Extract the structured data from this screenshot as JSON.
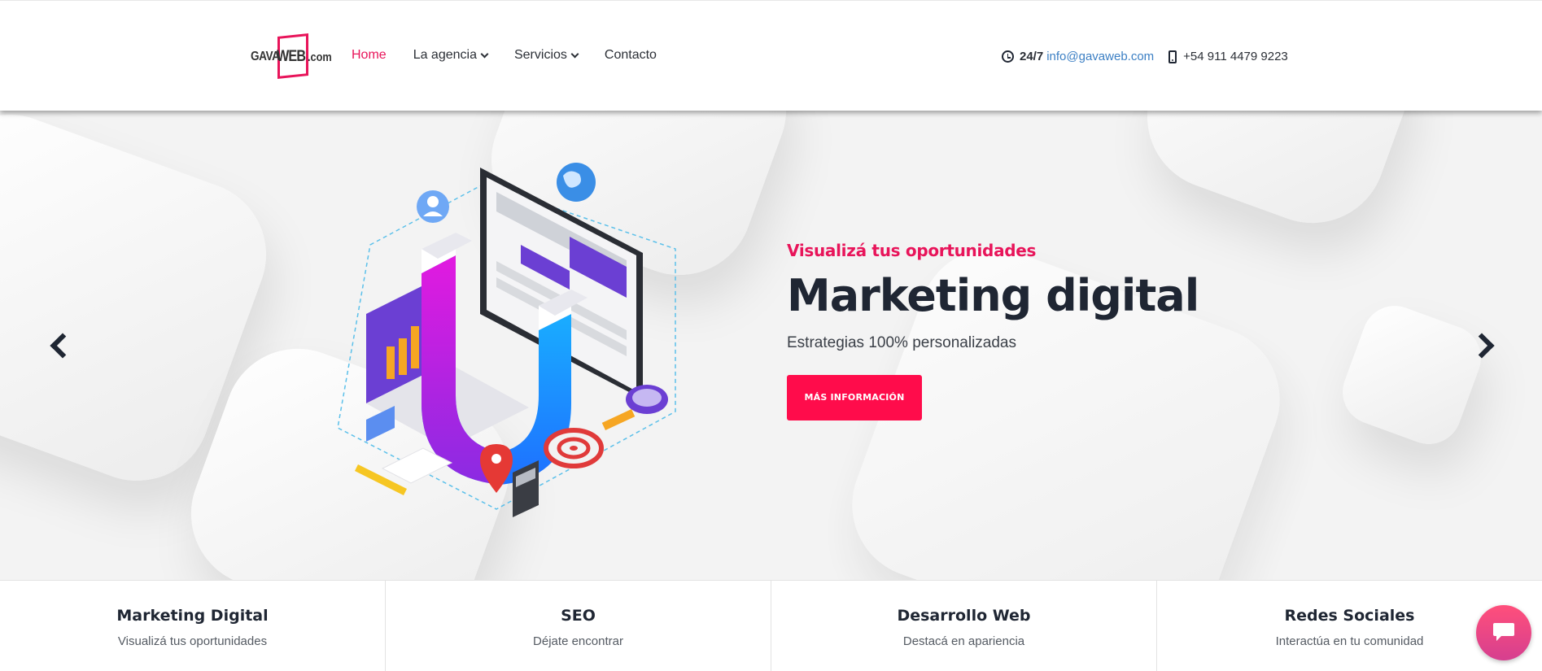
{
  "header": {
    "logo": {
      "part1": "GAVA",
      "part2": "WEB",
      "part3": ".com"
    },
    "nav": [
      {
        "label": "Home",
        "active": true,
        "has_dropdown": false
      },
      {
        "label": "La agencia",
        "active": false,
        "has_dropdown": true
      },
      {
        "label": "Servicios",
        "active": false,
        "has_dropdown": true
      },
      {
        "label": "Contacto",
        "active": false,
        "has_dropdown": false
      }
    ],
    "contact": {
      "hours": "24/7",
      "email": "info@gavaweb.com",
      "phone": "+54 911 4479 9223"
    }
  },
  "hero": {
    "kicker": "Visualizá tus oportunidades",
    "headline": "Marketing digital",
    "subline": "Estrategias 100% personalizadas",
    "cta_label": "MÁS INFORMACIÓN"
  },
  "services": [
    {
      "title": "Marketing Digital",
      "subtitle": "Visualizá tus oportunidades"
    },
    {
      "title": "SEO",
      "subtitle": "Déjate encontrar"
    },
    {
      "title": "Desarrollo Web",
      "subtitle": "Destacá en apariencia"
    },
    {
      "title": "Redes Sociales",
      "subtitle": "Interactúa en tu comunidad"
    }
  ],
  "colors": {
    "accent": "#e8145a",
    "cta": "#ff0c4b",
    "dark": "#1f2633",
    "link": "#3b7fc4"
  },
  "icons": {
    "clock": "clock-icon",
    "phone": "mobile-phone-icon",
    "prev": "chevron-left-icon",
    "next": "chevron-right-icon",
    "chat": "chat-bubble-icon"
  }
}
